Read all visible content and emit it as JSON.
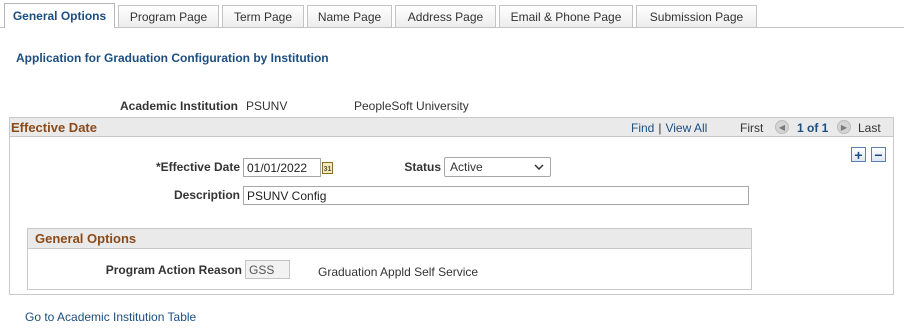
{
  "tabs": [
    {
      "label": "General Options",
      "active": true
    },
    {
      "label": "Program Page",
      "active": false
    },
    {
      "label": "Term Page",
      "active": false
    },
    {
      "label": "Name Page",
      "active": false
    },
    {
      "label": "Address Page",
      "active": false
    },
    {
      "label": "Email & Phone Page",
      "active": false
    },
    {
      "label": "Submission Page",
      "active": false
    }
  ],
  "page_title": "Application for Graduation Configuration by Institution",
  "institution": {
    "label": "Academic Institution",
    "code": "PSUNV",
    "name": "PeopleSoft University"
  },
  "effective_date_section": {
    "title": "Effective Date",
    "nav": {
      "find": "Find",
      "separator": "|",
      "view_all": "View All",
      "first": "First",
      "count": "1 of 1",
      "last": "Last"
    },
    "effective_date_label": "*Effective Date",
    "effective_date_value": "01/01/2022",
    "status_label": "Status",
    "status_value": "Active",
    "description_label": "Description",
    "description_value": "PSUNV Config",
    "add_row": "+",
    "delete_row": "−"
  },
  "general_options": {
    "title": "General Options",
    "program_action_reason_label": "Program Action Reason",
    "program_action_reason_code": "GSS",
    "program_action_reason_desc": "Graduation Appld Self Service"
  },
  "footer_link": "Go to Academic Institution Table",
  "colors": {
    "link": "#1c4e80",
    "section_title": "#8c4a18",
    "header_bg": "#eaeaea"
  }
}
